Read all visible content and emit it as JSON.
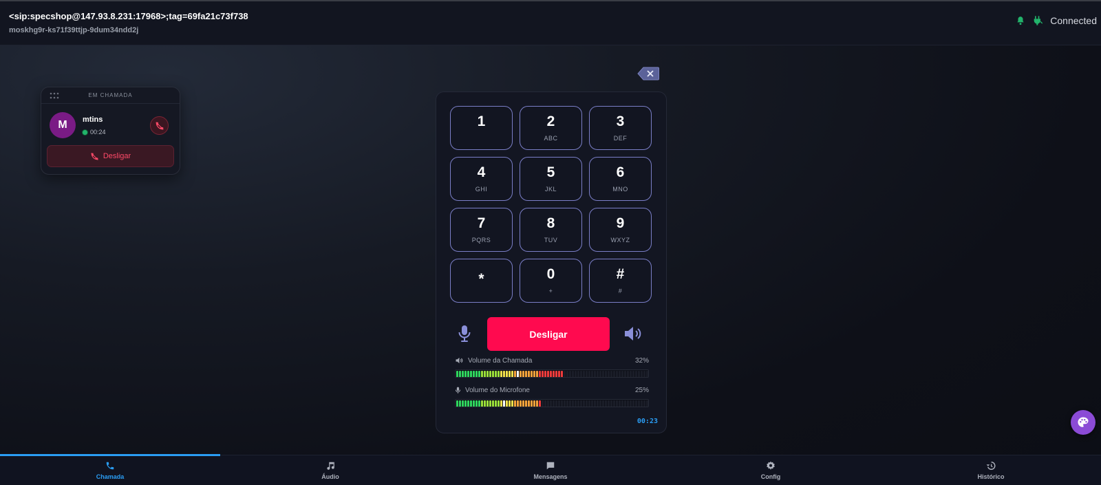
{
  "header": {
    "title": "<sip:specshop@147.93.8.231:17968>;tag=69fa21c73f738",
    "subtitle": "moskhg9r-ks71f39ttjp-9dum34ndd2j",
    "status": "Connected",
    "status_color": "#22b36b",
    "icons": [
      "bell-icon",
      "plug-icon"
    ]
  },
  "mini_call": {
    "title": "EM CHAMADA",
    "avatar_letter": "M",
    "avatar_color": "#7a1b85",
    "caller": "mtins",
    "elapsed": "00:24",
    "hangup_label": "Desligar"
  },
  "dialpad": {
    "keys": [
      {
        "num": "1",
        "letters": ""
      },
      {
        "num": "2",
        "letters": "ABC"
      },
      {
        "num": "3",
        "letters": "DEF"
      },
      {
        "num": "4",
        "letters": "GHI"
      },
      {
        "num": "5",
        "letters": "JKL"
      },
      {
        "num": "6",
        "letters": "MNO"
      },
      {
        "num": "7",
        "letters": "PQRS"
      },
      {
        "num": "8",
        "letters": "TUV"
      },
      {
        "num": "9",
        "letters": "WXYZ"
      },
      {
        "num": "*",
        "letters": ""
      },
      {
        "num": "0",
        "letters": "+"
      },
      {
        "num": "#",
        "letters": "#"
      }
    ],
    "hangup_label": "Desligar",
    "hangup_color": "#ff0a4f",
    "call_volume": {
      "label": "Volume da Chamada",
      "value": "32%",
      "level": 0.32
    },
    "mic_volume": {
      "label": "Volume do Microfone",
      "value": "25%",
      "level": 0.25
    },
    "timer": "00:23"
  },
  "nav": {
    "items": [
      {
        "label": "Chamada",
        "icon": "phone-icon",
        "active": true
      },
      {
        "label": "Áudio",
        "icon": "music-icon",
        "active": false
      },
      {
        "label": "Mensagens",
        "icon": "message-icon",
        "active": false
      },
      {
        "label": "Config",
        "icon": "gear-icon",
        "active": false
      },
      {
        "label": "Histórico",
        "icon": "history-icon",
        "active": false
      }
    ],
    "accent": "#2a9df4"
  }
}
